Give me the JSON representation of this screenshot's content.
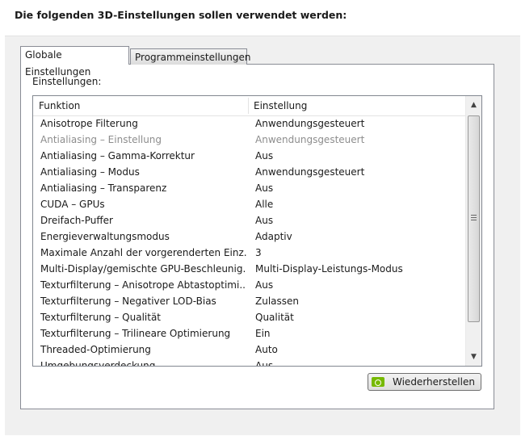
{
  "header": {
    "title": "Die folgenden 3D-Einstellungen sollen verwendet werden:"
  },
  "tabs": [
    {
      "label": "Globale Einstellungen"
    },
    {
      "label": "Programmeinstellungen"
    }
  ],
  "settings_label": "Einstellungen:",
  "table": {
    "columns": [
      "Funktion",
      "Einstellung"
    ],
    "rows": [
      {
        "function": "Anisotrope Filterung",
        "value": "Anwendungsgesteuert"
      },
      {
        "function": "Antialiasing – Einstellung",
        "value": "Anwendungsgesteuert"
      },
      {
        "function": "Antialiasing – Gamma-Korrektur",
        "value": "Aus"
      },
      {
        "function": "Antialiasing – Modus",
        "value": "Anwendungsgesteuert"
      },
      {
        "function": "Antialiasing – Transparenz",
        "value": "Aus"
      },
      {
        "function": "CUDA – GPUs",
        "value": "Alle"
      },
      {
        "function": "Dreifach-Puffer",
        "value": "Aus"
      },
      {
        "function": "Energieverwaltungsmodus",
        "value": "Adaptiv"
      },
      {
        "function": "Maximale Anzahl der vorgerenderten Einz...",
        "value": "3"
      },
      {
        "function": "Multi-Display/gemischte GPU-Beschleunig...",
        "value": "Multi-Display-Leistungs-Modus"
      },
      {
        "function": "Texturfilterung – Anisotrope Abtastoptimi...",
        "value": "Aus"
      },
      {
        "function": "Texturfilterung – Negativer LOD-Bias",
        "value": "Zulassen"
      },
      {
        "function": "Texturfilterung – Qualität",
        "value": "Qualität"
      },
      {
        "function": "Texturfilterung – Trilineare Optimierung",
        "value": "Ein"
      },
      {
        "function": "Threaded-Optimierung",
        "value": "Auto"
      },
      {
        "function": "Umgebungsverdeckung",
        "value": "Aus"
      }
    ]
  },
  "restore_button": {
    "label": "Wiederherstellen"
  },
  "colors": {
    "accent_icon": "#76b900"
  }
}
